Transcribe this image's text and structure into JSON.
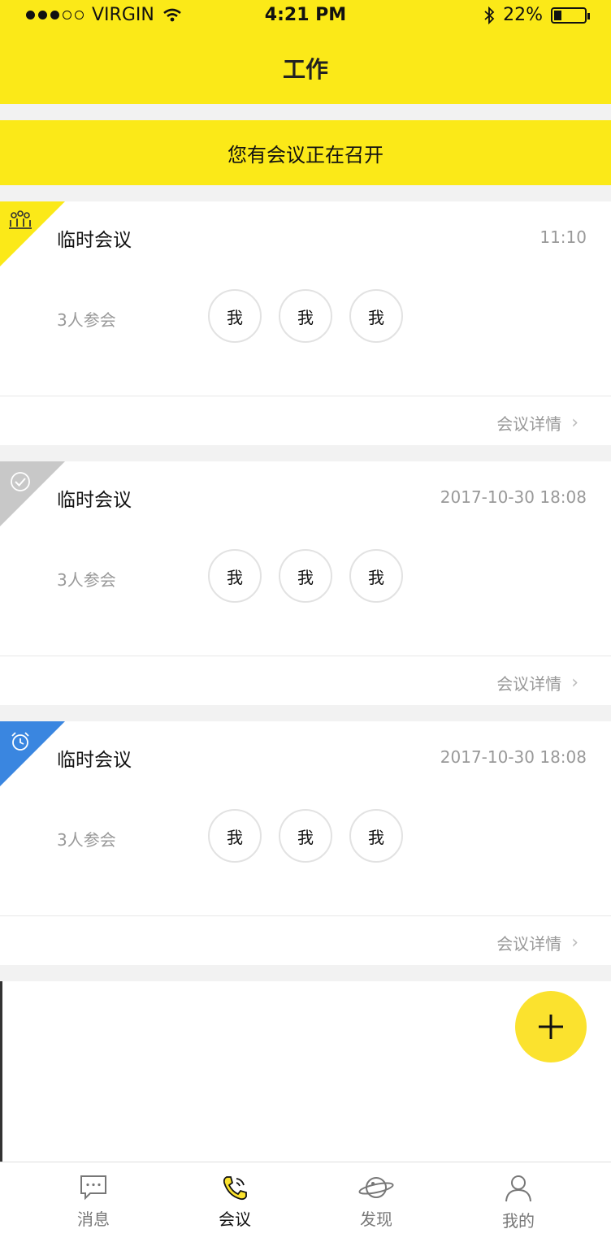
{
  "status_bar": {
    "carrier": "VIRGIN",
    "time": "4:21 PM",
    "battery": "22%",
    "battery_level": 0.22,
    "icons": [
      "signal-dots",
      "wifi-icon",
      "bluetooth-icon",
      "battery-icon"
    ]
  },
  "nav": {
    "title": "工作"
  },
  "banner": {
    "text": "您有会议正在召开"
  },
  "meetings": [
    {
      "title": "临时会议",
      "time": "11:10",
      "count": "3人参会",
      "avatars": [
        "我",
        "我",
        "我"
      ],
      "detail": "会议详情",
      "badge_color": "#fbe918",
      "badge_icon": "meeting-people-icon"
    },
    {
      "title": "临时会议",
      "time": "2017-10-30 18:08",
      "count": "3人参会",
      "avatars": [
        "我",
        "我",
        "我"
      ],
      "detail": "会议详情",
      "badge_color": "#c8c8c8",
      "badge_icon": "check-circle-icon"
    },
    {
      "title": "临时会议",
      "time": "2017-10-30 18:08",
      "count": "3人参会",
      "avatars": [
        "我",
        "我",
        "我"
      ],
      "detail": "会议详情",
      "badge_color": "#3a86e0",
      "badge_icon": "alarm-clock-icon"
    }
  ],
  "fab": {
    "icon": "plus-icon",
    "color": "#fbe22e"
  },
  "tabbar": {
    "tabs": [
      {
        "label": "消息",
        "icon": "message-icon"
      },
      {
        "label": "会议",
        "icon": "phone-icon",
        "active": true
      },
      {
        "label": "发现",
        "icon": "planet-icon"
      },
      {
        "label": "我的",
        "icon": "user-icon"
      }
    ]
  }
}
